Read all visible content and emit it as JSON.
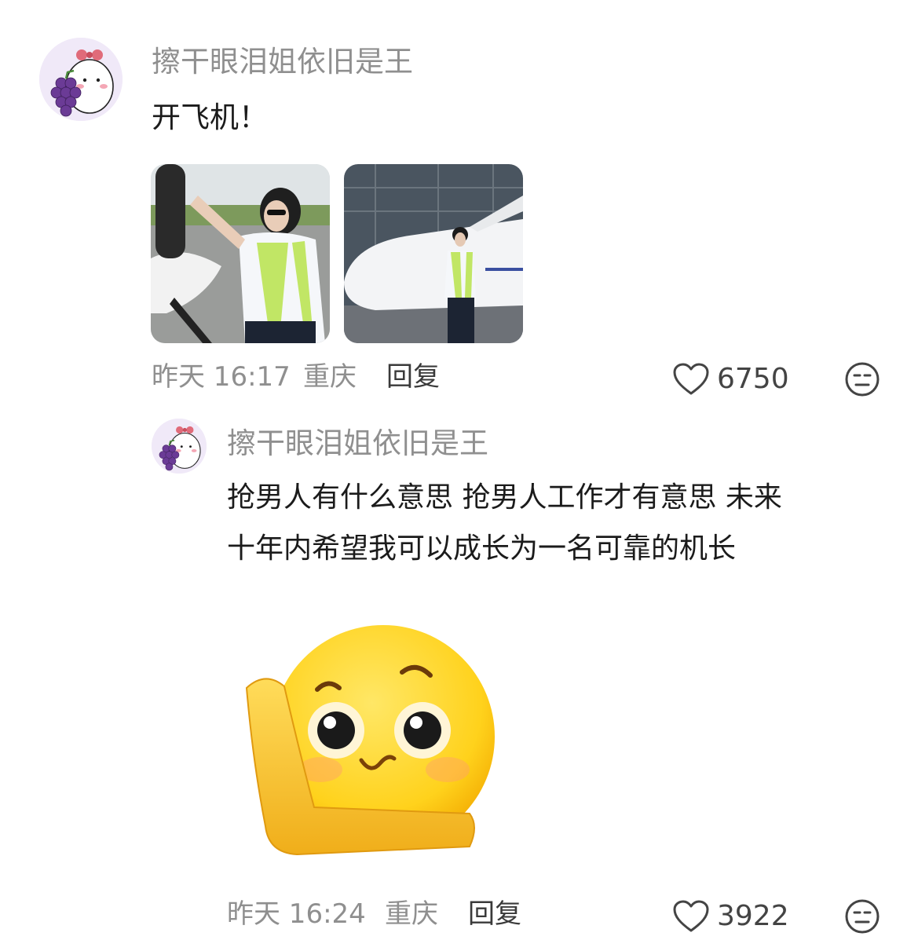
{
  "comment": {
    "username": "擦干眼泪姐依旧是王",
    "text": "开飞机！",
    "time": "昨天 16:17",
    "location": "重庆",
    "reply_label": "回复",
    "likes": "6750"
  },
  "reply": {
    "username": "擦干眼泪姐依旧是王",
    "text_line1": "抢男人有什么意思 抢男人工作才有意思 未来",
    "text_line2": "十年内希望我可以成长为一名可靠的机长",
    "time": "昨天 16:24",
    "location": "重庆",
    "reply_label": "回复",
    "likes": "3922"
  },
  "icons": {
    "like": "heart-outline-icon",
    "reaction": "expressionless-face-icon"
  }
}
